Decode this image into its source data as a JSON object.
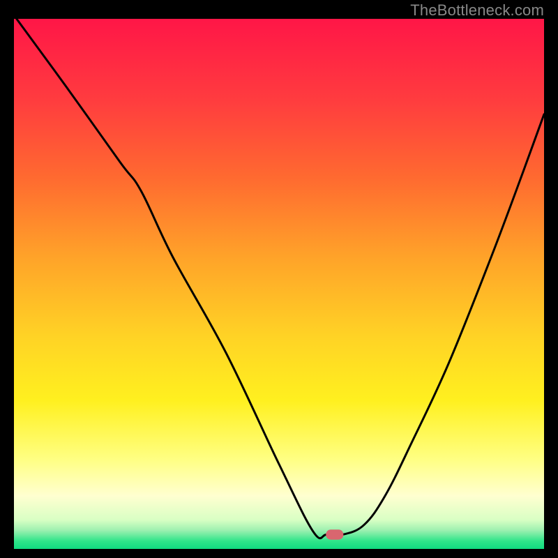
{
  "watermark": "TheBottleneck.com",
  "chart_data": {
    "type": "line",
    "title": "",
    "xlabel": "",
    "ylabel": "",
    "xlim": [
      0,
      100
    ],
    "ylim": [
      0,
      100
    ],
    "gradient_stops": [
      {
        "offset": 0.0,
        "color": "#ff1647"
      },
      {
        "offset": 0.15,
        "color": "#ff3b3f"
      },
      {
        "offset": 0.3,
        "color": "#ff6a30"
      },
      {
        "offset": 0.45,
        "color": "#ffa329"
      },
      {
        "offset": 0.6,
        "color": "#ffd325"
      },
      {
        "offset": 0.72,
        "color": "#fff01f"
      },
      {
        "offset": 0.83,
        "color": "#ffff82"
      },
      {
        "offset": 0.9,
        "color": "#ffffd0"
      },
      {
        "offset": 0.945,
        "color": "#d9ffc4"
      },
      {
        "offset": 0.965,
        "color": "#9cf0b0"
      },
      {
        "offset": 0.985,
        "color": "#30e58a"
      },
      {
        "offset": 1.0,
        "color": "#10db80"
      }
    ],
    "series": [
      {
        "name": "bottleneck-curve",
        "x": [
          0.5,
          10,
          20,
          24,
          30,
          40,
          50,
          56.5,
          59,
          62,
          66,
          70,
          75,
          82,
          90,
          96,
          100
        ],
        "y": [
          100,
          87,
          73,
          67.5,
          55,
          37,
          16,
          3.2,
          2.7,
          2.7,
          4.5,
          10,
          20,
          35,
          55,
          71,
          82
        ]
      }
    ],
    "marker": {
      "name": "optimal-marker",
      "x": 60.5,
      "y": 2.7,
      "width_pct": 3.3,
      "height_pct": 1.9,
      "color": "#d9666f"
    }
  }
}
